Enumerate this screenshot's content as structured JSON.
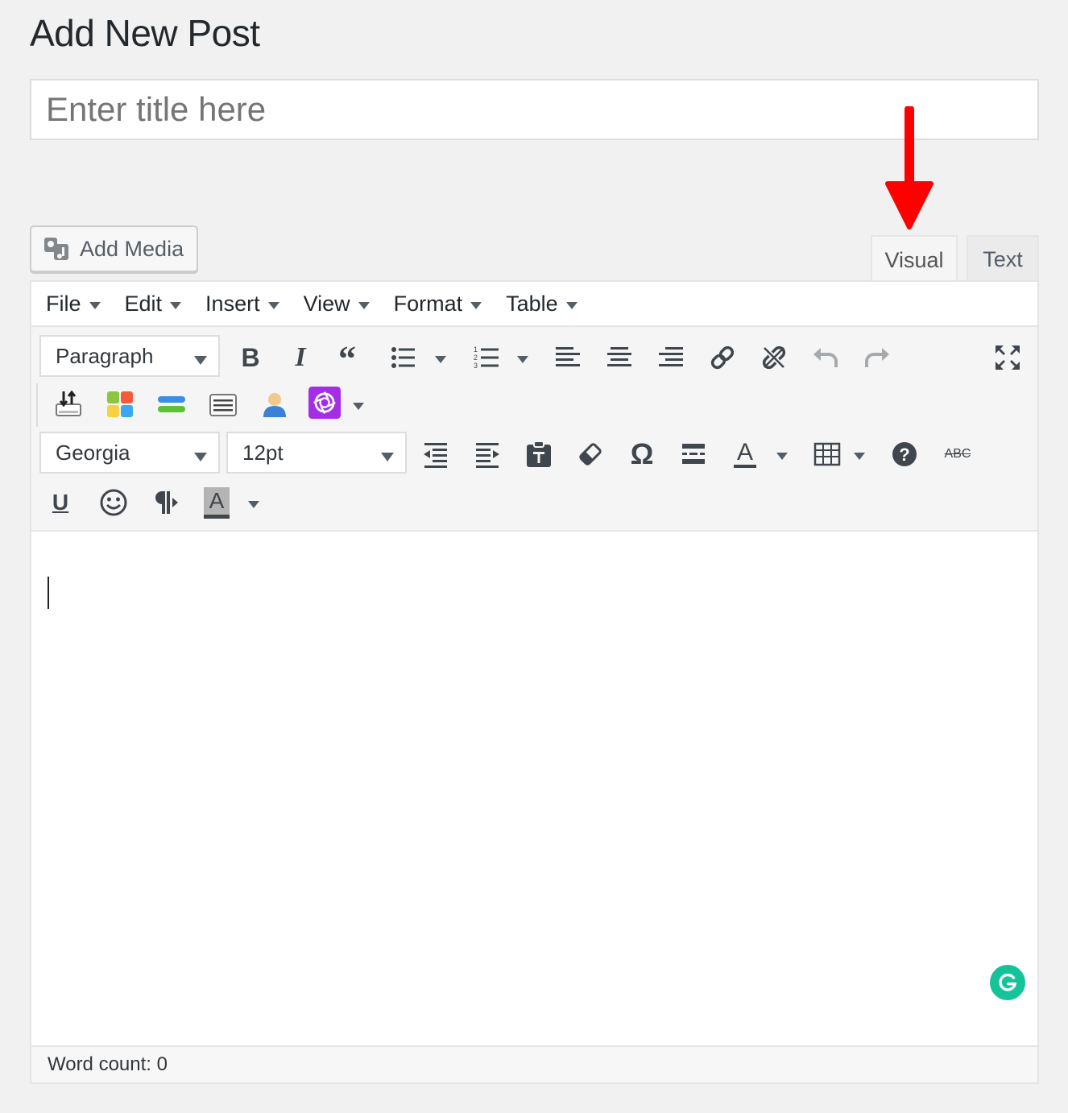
{
  "page": {
    "title": "Add New Post"
  },
  "title_field": {
    "placeholder": "Enter title here",
    "value": ""
  },
  "add_media": {
    "label": "Add Media"
  },
  "tabs": {
    "visual": "Visual",
    "text": "Text"
  },
  "menubar": [
    "File",
    "Edit",
    "Insert",
    "View",
    "Format",
    "Table"
  ],
  "toolbar": {
    "block_format": "Paragraph",
    "font_family": "Georgia",
    "font_size": "12pt",
    "bold": "B",
    "italic": "I",
    "strikethrough": "ABC",
    "underline": "U",
    "text_color": "A",
    "bg_color": "A"
  },
  "status": {
    "word_count": "Word count: 0"
  },
  "colors": {
    "arrow": "#ff0000",
    "grammarly": "#15c39a",
    "plugin_purple": "#a32ee6"
  }
}
